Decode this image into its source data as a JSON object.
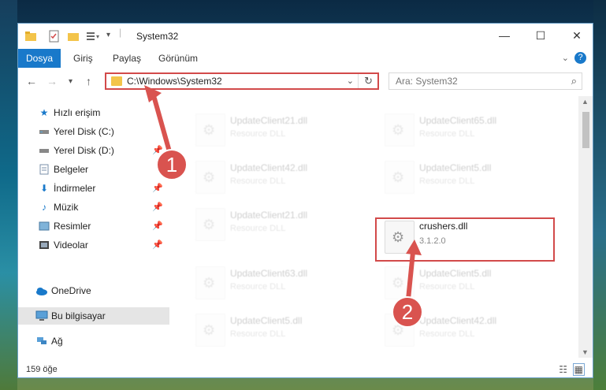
{
  "window": {
    "title": "System32"
  },
  "window_controls": {
    "minimize": "—",
    "maximize": "☐",
    "close": "✕"
  },
  "ribbon": {
    "tabs": [
      "Dosya",
      "Giriş",
      "Paylaş",
      "Görünüm"
    ]
  },
  "address": {
    "path": "C:\\Windows\\System32"
  },
  "search": {
    "placeholder": "Ara: System32"
  },
  "sidebar": {
    "items": [
      {
        "label": "Hızlı erişim",
        "icon": "star-icon"
      },
      {
        "label": "Yerel Disk (C:)",
        "icon": "drive-icon"
      },
      {
        "label": "Yerel Disk (D:)",
        "icon": "drive-icon"
      },
      {
        "label": "Belgeler",
        "icon": "documents-icon"
      },
      {
        "label": "İndirmeler",
        "icon": "download-icon"
      },
      {
        "label": "Müzik",
        "icon": "music-icon"
      },
      {
        "label": "Resimler",
        "icon": "pictures-icon"
      },
      {
        "label": "Videolar",
        "icon": "video-icon"
      },
      {
        "label": "OneDrive",
        "icon": "cloud-icon"
      },
      {
        "label": "Bu bilgisayar",
        "icon": "computer-icon"
      },
      {
        "label": "Ağ",
        "icon": "network-icon"
      }
    ]
  },
  "files": [
    {
      "name": "UpdateClient21.dll",
      "type": "Resource DLL"
    },
    {
      "name": "UpdateClient65.dll",
      "type": "Resource DLL"
    },
    {
      "name": "UpdateClient42.dll",
      "type": "Resource DLL"
    },
    {
      "name": "UpdateClient5.dll",
      "type": "Resource DLL"
    },
    {
      "name": "UpdateClient21.dll",
      "type": "Resource DLL"
    },
    {
      "name": "crushers.dll",
      "type": "3.1.2.0"
    },
    {
      "name": "UpdateClient63.dll",
      "type": "Resource DLL"
    },
    {
      "name": "UpdateClient5.dll",
      "type": "Resource DLL"
    },
    {
      "name": "UpdateClient5.dll",
      "type": "Resource DLL"
    },
    {
      "name": "UpdateClient42.dll",
      "type": "Resource DLL"
    }
  ],
  "status": {
    "count": "159 öğe"
  },
  "annotations": {
    "step1": "1",
    "step2": "2"
  },
  "colors": {
    "accent": "#1979ca",
    "highlight": "#d24a4a"
  }
}
